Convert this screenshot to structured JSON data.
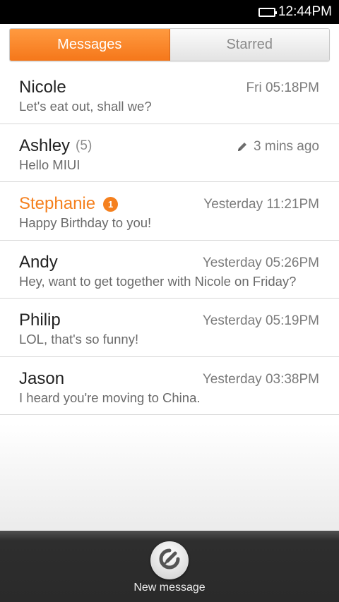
{
  "status_bar": {
    "time": "12:44PM",
    "icon": "battery-icon"
  },
  "tabs": [
    {
      "label": "Messages",
      "active": true
    },
    {
      "label": "Starred",
      "active": false
    }
  ],
  "conversations": [
    {
      "name": "Nicole",
      "count": "",
      "badge": "",
      "time": "Fri 05:18PM",
      "preview": "Let's eat out, shall we?",
      "draft": false,
      "unread": false
    },
    {
      "name": "Ashley",
      "count": "(5)",
      "badge": "",
      "time": "3 mins ago",
      "preview": "Hello MIUI",
      "draft": true,
      "unread": false
    },
    {
      "name": "Stephanie",
      "count": "",
      "badge": "1",
      "time": "Yesterday 11:21PM",
      "preview": "Happy Birthday to you!",
      "draft": false,
      "unread": true
    },
    {
      "name": "Andy",
      "count": "",
      "badge": "",
      "time": "Yesterday 05:26PM",
      "preview": "Hey, want to get together with Nicole on Friday?",
      "draft": false,
      "unread": false
    },
    {
      "name": "Philip",
      "count": "",
      "badge": "",
      "time": "Yesterday 05:19PM",
      "preview": "LOL, that's so funny!",
      "draft": false,
      "unread": false
    },
    {
      "name": "Jason",
      "count": "",
      "badge": "",
      "time": "Yesterday 03:38PM",
      "preview": "I heard you're moving to China.",
      "draft": false,
      "unread": false
    }
  ],
  "bottom": {
    "new_message_label": "New message",
    "icon": "compose-icon"
  },
  "colors": {
    "accent": "#f5801e",
    "status_bg": "#000000",
    "bottom_bg": "#2e2e2e"
  }
}
